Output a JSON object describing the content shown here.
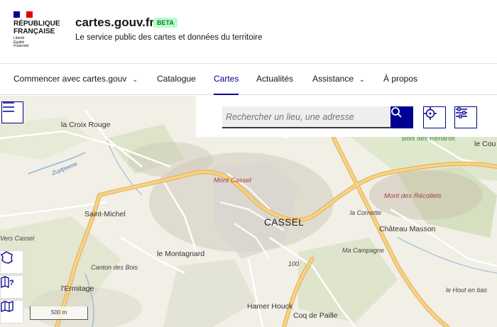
{
  "header": {
    "marianne_line1": "RÉPUBLIQUE",
    "marianne_line2": "FRANÇAISE",
    "devise_1": "Liberté",
    "devise_2": "Égalité",
    "devise_3": "Fraternité",
    "site_name": "cartes.gouv.fr",
    "badge": "BETA",
    "tagline": "Le service public des cartes et données du territoire"
  },
  "nav": {
    "items": [
      {
        "label": "Commencer avec cartes.gouv",
        "chevron": true
      },
      {
        "label": "Catalogue"
      },
      {
        "label": "Cartes",
        "active": true
      },
      {
        "label": "Actualités"
      },
      {
        "label": "Assistance",
        "chevron": true
      },
      {
        "label": "À propos"
      }
    ]
  },
  "search": {
    "placeholder": "Rechercher un lieu, une adresse"
  },
  "map": {
    "scale_label": "500 m",
    "places": {
      "la_croix_rouge": "la Croix Rouge",
      "saint_michel": "Saint-Michel",
      "le_montagnard": "le Montagnard",
      "canton_des_bois": "Canton des Bois",
      "lermitage": "l'Ermitage",
      "mont_cassel": "Mont Cassel",
      "cassel": "CASSEL",
      "la_cornette": "la Cornette",
      "chateau_masson": "Château Masson",
      "ma_campagne": "Ma Campagne",
      "mont_des_recollets": "Mont des Récollets",
      "bois_des_renards": "Bois des Renards",
      "le_cou": "le Cou",
      "le_hout_en_bas": "le Hout en bas",
      "hamer_houck": "Hamer Houck",
      "coq_de_paille": "Coq de Paille",
      "vers_cassel": "Vers Cassel",
      "zuytpeene": "Zuytpeene",
      "contour_100": "100"
    }
  },
  "colors": {
    "primary": "#000091",
    "flag_blue": "#000091",
    "flag_white": "#ffffff",
    "flag_red": "#e1000f",
    "beta_bg": "#b8fec9",
    "beta_text": "#18753c",
    "road_major": "#f3c672"
  },
  "icons": {
    "menu": "menu-icon",
    "search": "search-icon",
    "geolocate": "crosshair-icon",
    "filters": "sliders-icon",
    "territory": "france-icon",
    "map_question": "map-question-icon",
    "map_layers": "map-icon"
  }
}
